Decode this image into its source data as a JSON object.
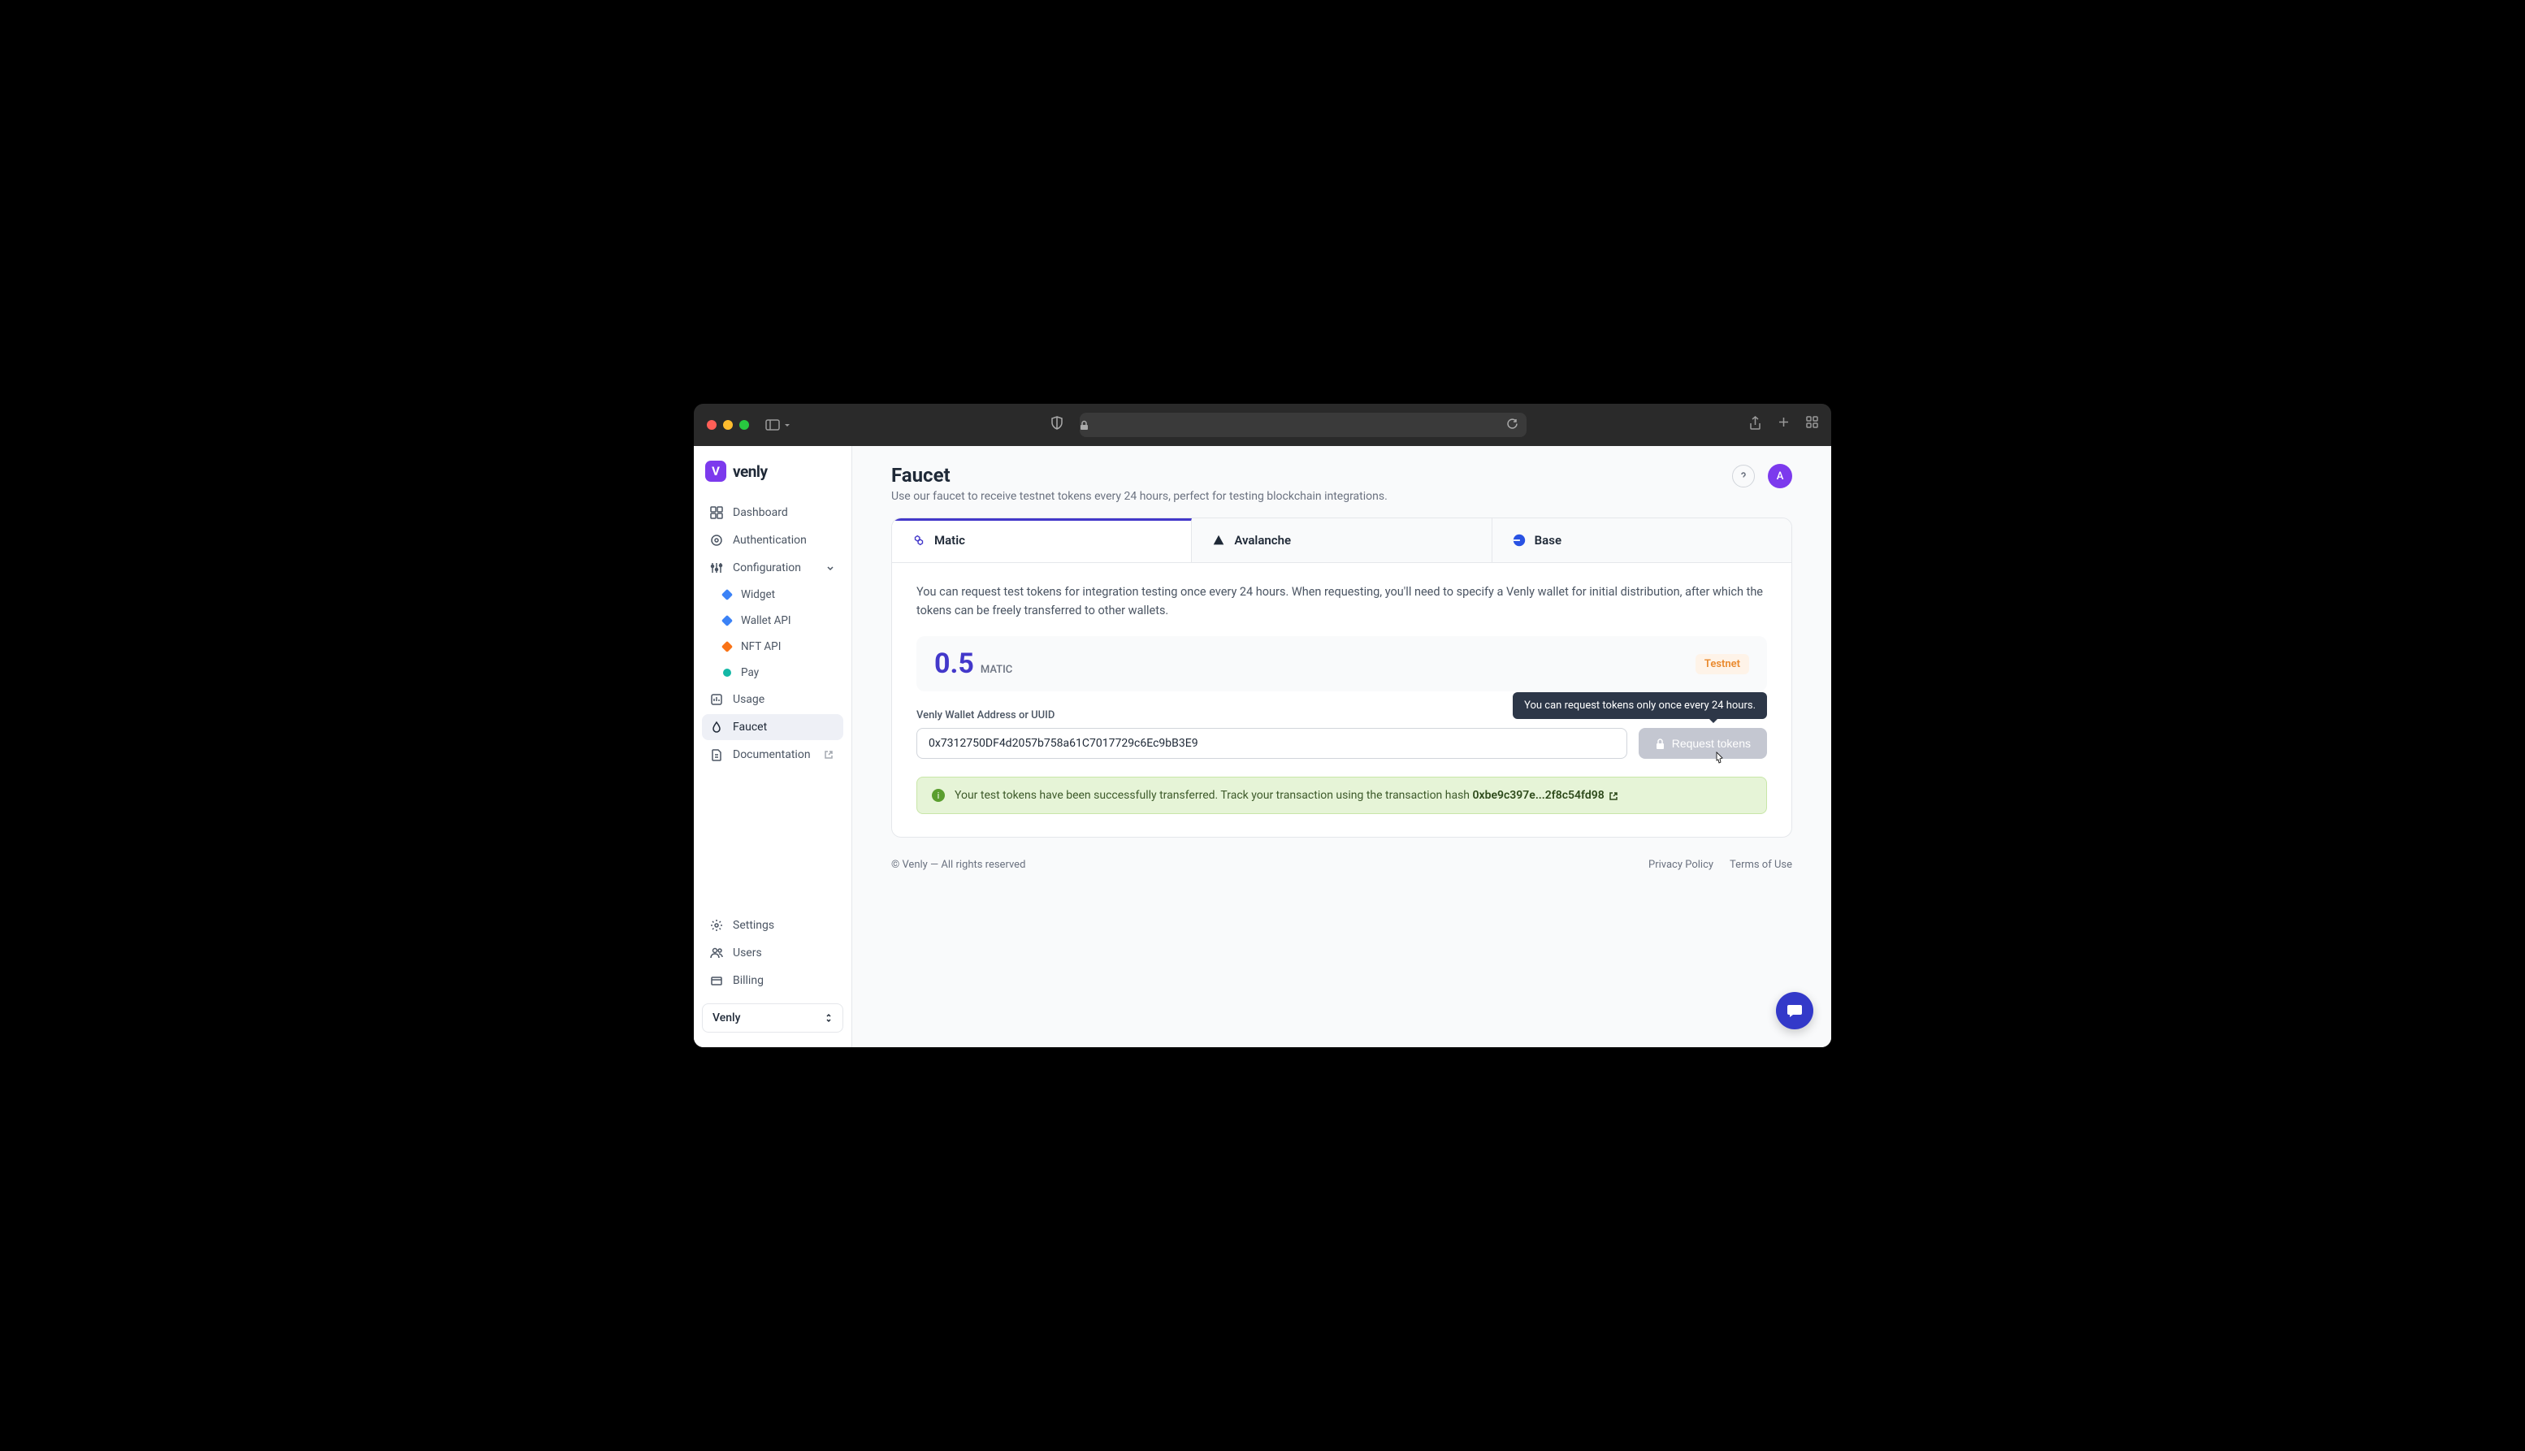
{
  "brand": {
    "name": "venly",
    "badge_letter": "V"
  },
  "sidebar": {
    "items": [
      {
        "label": "Dashboard"
      },
      {
        "label": "Authentication"
      },
      {
        "label": "Configuration"
      },
      {
        "label": "Usage"
      },
      {
        "label": "Faucet"
      },
      {
        "label": "Documentation"
      }
    ],
    "config_children": [
      {
        "label": "Widget"
      },
      {
        "label": "Wallet API"
      },
      {
        "label": "NFT API"
      },
      {
        "label": "Pay"
      }
    ],
    "bottom_items": [
      {
        "label": "Settings"
      },
      {
        "label": "Users"
      },
      {
        "label": "Billing"
      }
    ],
    "org_selector": "Venly"
  },
  "header": {
    "title": "Faucet",
    "description": "Use our faucet to receive testnet tokens every 24 hours, perfect for testing blockchain integrations.",
    "avatar_letter": "A"
  },
  "tabs": [
    {
      "label": "Matic"
    },
    {
      "label": "Avalanche"
    },
    {
      "label": "Base"
    }
  ],
  "info_text": "You can request test tokens for integration testing once every 24 hours. When requesting, you'll need to specify a Venly wallet for initial distribution, after which the tokens can be freely transferred to other wallets.",
  "amount": {
    "value": "0.5",
    "unit": "MATIC",
    "badge": "Testnet"
  },
  "form": {
    "label": "Venly Wallet Address or UUID",
    "value": "0x7312750DF4d2057b758a61C7017729c6Ec9bB3E9",
    "button": "Request tokens",
    "tooltip": "You can request tokens only once every 24 hours."
  },
  "success": {
    "message": "Your test tokens have been successfully transferred. Track your transaction using the transaction hash ",
    "hash": "0xbe9c397e...2f8c54fd98"
  },
  "footer": {
    "copyright": "© Venly — All rights reserved",
    "links": [
      "Privacy Policy",
      "Terms of Use"
    ]
  }
}
